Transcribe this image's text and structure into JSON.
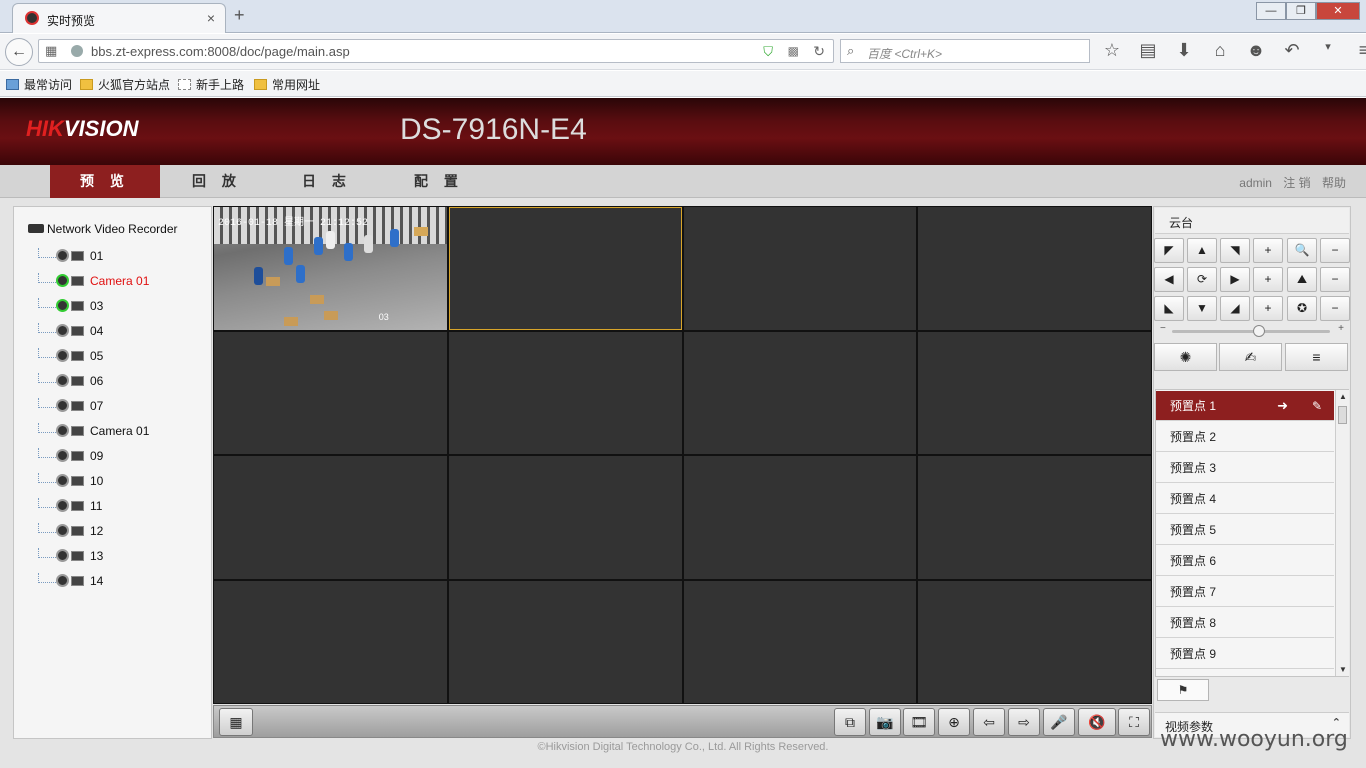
{
  "browser": {
    "tab_title": "实时预览",
    "tab_close": "×",
    "new_tab": "+",
    "url": "bbs.zt-express.com:8008/doc/page/main.asp",
    "search_placeholder": "百度 <Ctrl+K>",
    "window_buttons": [
      "—",
      "❐",
      "✕"
    ],
    "toolbar_icons": [
      "star-icon",
      "reading-list-icon",
      "download-icon",
      "home-icon",
      "chat-icon",
      "undo-icon",
      "dropdown-icon",
      "menu-icon"
    ],
    "bookmarks": [
      "最常访问",
      "火狐官方站点",
      "新手上路",
      "常用网址"
    ]
  },
  "app": {
    "logo": "HIKVISION",
    "model": "DS-7916N-E4",
    "menu": [
      "预 览",
      "回 放",
      "日 志",
      "配 置"
    ],
    "active_menu_index": 0,
    "user": "admin",
    "logout": "注 销",
    "help": "帮助"
  },
  "tree": {
    "root": "Network Video Recorder",
    "cameras": [
      {
        "label": "01",
        "online": false,
        "selected": false
      },
      {
        "label": "Camera 01",
        "online": true,
        "selected": true
      },
      {
        "label": "03",
        "online": true,
        "selected": false
      },
      {
        "label": "04",
        "online": false,
        "selected": false
      },
      {
        "label": "05",
        "online": false,
        "selected": false
      },
      {
        "label": "06",
        "online": false,
        "selected": false
      },
      {
        "label": "07",
        "online": false,
        "selected": false
      },
      {
        "label": "Camera 01",
        "online": false,
        "selected": false
      },
      {
        "label": "09",
        "online": false,
        "selected": false
      },
      {
        "label": "10",
        "online": false,
        "selected": false
      },
      {
        "label": "11",
        "online": false,
        "selected": false
      },
      {
        "label": "12",
        "online": false,
        "selected": false
      },
      {
        "label": "13",
        "online": false,
        "selected": false
      },
      {
        "label": "14",
        "online": false,
        "selected": false
      }
    ]
  },
  "video": {
    "osd_text": "2016-01-18 星期一 21:12:52",
    "channel_label": "03",
    "selected_cell": 1
  },
  "ptz": {
    "title": "云台",
    "grid": [
      "◤",
      "▲",
      "◥",
      "+",
      "🔍",
      "−",
      "◀",
      "⟳",
      "▶",
      "+",
      "⛰",
      "−",
      "◣",
      "▼",
      "◢",
      "+",
      "✪",
      "−"
    ],
    "slider_minus": "−",
    "slider_plus": "+",
    "slider_level": 0.55,
    "function_icons": [
      "✺",
      "✍",
      "≡"
    ]
  },
  "presets": {
    "items": [
      "预置点 1",
      "预置点 2",
      "预置点 3",
      "预置点 4",
      "预置点 5",
      "预置点 6",
      "预置点 7",
      "预置点 8",
      "预置点 9"
    ],
    "active_index": 0,
    "go_icon": "➜",
    "edit_icon": "✎",
    "flag_icon": "⚑"
  },
  "video_params": {
    "label": "视频参数",
    "chevron": "⌃"
  },
  "bottom_toolbar": {
    "layout_icon": "▦",
    "buttons": [
      "⧉",
      "📷",
      "🎞",
      "⊕",
      "⇦",
      "⇨",
      "🎤",
      "🔇",
      "⛶"
    ]
  },
  "footer": "©Hikvision Digital Technology Co., Ltd. All Rights Reserved.",
  "watermark": "www.wooyun.org"
}
